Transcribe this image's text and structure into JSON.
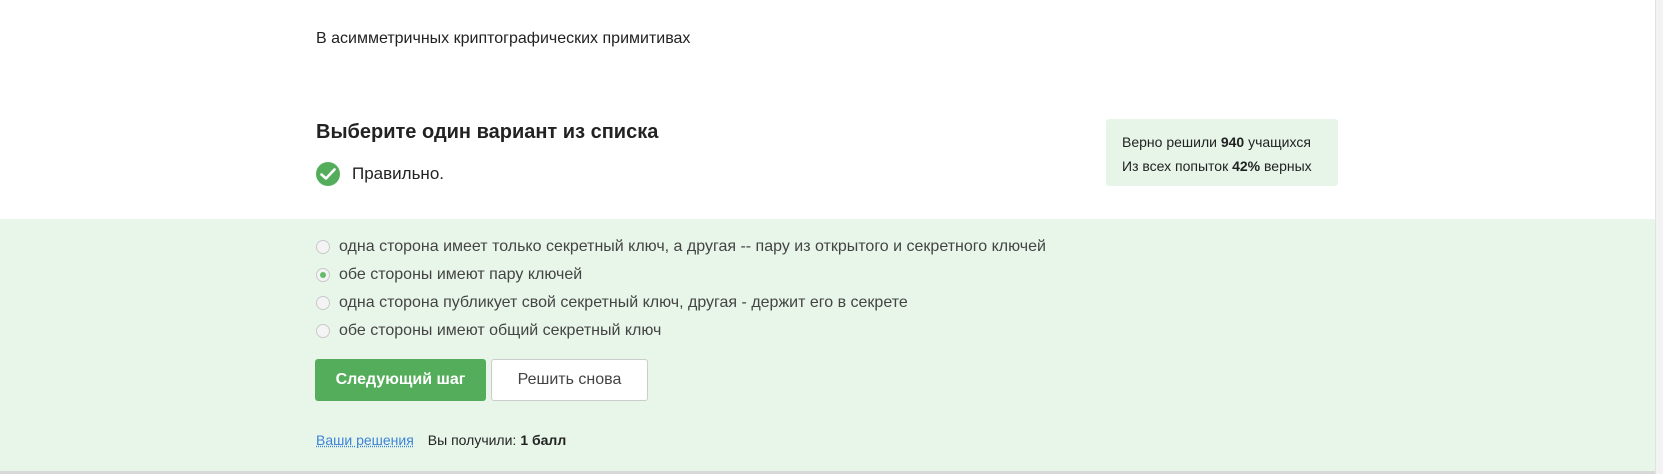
{
  "question": {
    "text": "В асимметричных криптографических примитивах"
  },
  "task": {
    "title": "Выберите один вариант из списка",
    "result_label": "Правильно."
  },
  "stats": {
    "solved_prefix": "Верно решили",
    "solved_count": "940",
    "solved_suffix": "учащихся",
    "attempts_prefix": "Из всех попыток",
    "attempts_percent": "42%",
    "attempts_suffix": "верных"
  },
  "options": [
    {
      "label": "одна сторона имеет только секретный ключ, а другая -- пару из открытого и секретного ключей",
      "selected": false
    },
    {
      "label": "обе стороны имеют пару ключей",
      "selected": true
    },
    {
      "label": "одна сторона публикует свой секретный ключ, другая - держит его в секрете",
      "selected": false
    },
    {
      "label": "обе стороны имеют общий секретный ключ",
      "selected": false
    }
  ],
  "buttons": {
    "next_label": "Следующий шаг",
    "retry_label": "Решить снова"
  },
  "footer": {
    "solutions_link": "Ваши решения",
    "score_label": "Вы получили:",
    "score_value": "1 балл"
  },
  "colors": {
    "accent_green": "#54ad5b",
    "panel_bg": "#e8f6ea",
    "stats_bg": "#e6f5e8",
    "link_blue": "#3b83d6"
  },
  "icons": {
    "result": "check-circle-icon"
  }
}
